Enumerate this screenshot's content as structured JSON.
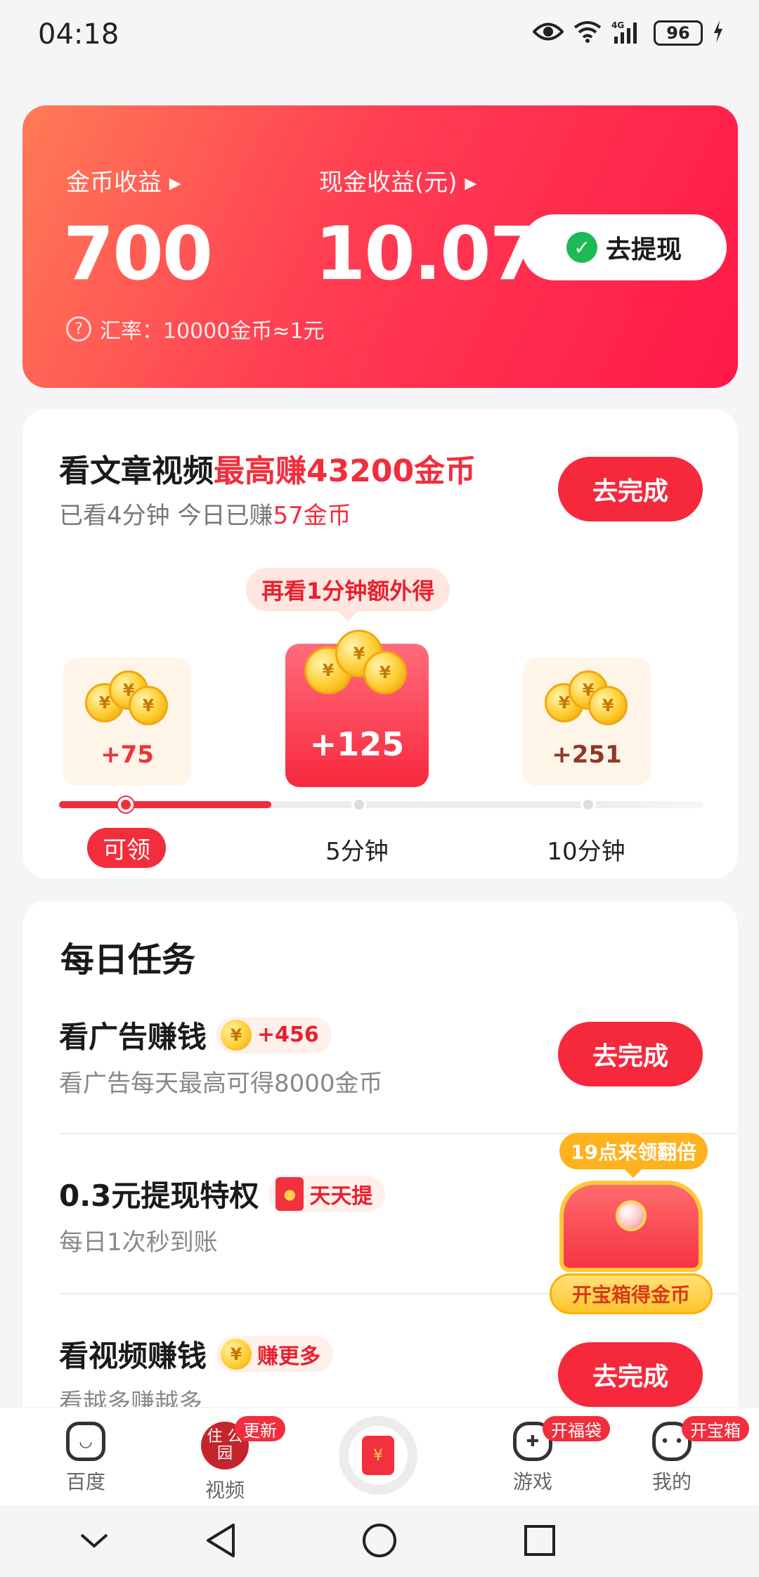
{
  "status": {
    "time": "04:18",
    "battery": "96"
  },
  "earnings": {
    "coin_label": "金币收益",
    "coin_value": "700",
    "cash_label": "现金收益(元)",
    "cash_value": "10.07",
    "withdraw_label": "去提现",
    "rate_text": "汇率：10000金币≈1元"
  },
  "video_task": {
    "title_prefix": "看文章视频",
    "title_highlight": "最高赚43200金币",
    "sub_prefix": "已看4分钟 今日已赚",
    "sub_highlight": "57金币",
    "button": "去完成",
    "tip": "再看1分钟额外得",
    "rewards": [
      "+75",
      "+125",
      "+251"
    ],
    "progress_fraction": 0.33,
    "milestones": [
      "可领",
      "5分钟",
      "10分钟"
    ]
  },
  "daily_tasks": {
    "heading": "每日任务",
    "items": [
      {
        "title": "看广告赚钱",
        "tag": "+456",
        "desc": "看广告每天最高可得8000金币",
        "button": "去完成"
      },
      {
        "title": "0.3元提现特权",
        "tag": "天天提",
        "desc": "每日1次秒到账",
        "button": ""
      },
      {
        "title": "看视频赚钱",
        "tag": "赚更多",
        "desc": "看越多赚越多",
        "button": "去完成"
      }
    ],
    "chest_badge": "19点来领翻倍",
    "chest_banner": "开宝箱得金币"
  },
  "tabbar": {
    "tabs": [
      {
        "label": "百度",
        "badge": ""
      },
      {
        "label": "视频",
        "badge": "更新",
        "avatar_text": "住 公园"
      },
      {
        "label": "游戏",
        "badge": "开福袋"
      },
      {
        "label": "我的",
        "badge": "开宝箱"
      }
    ]
  }
}
